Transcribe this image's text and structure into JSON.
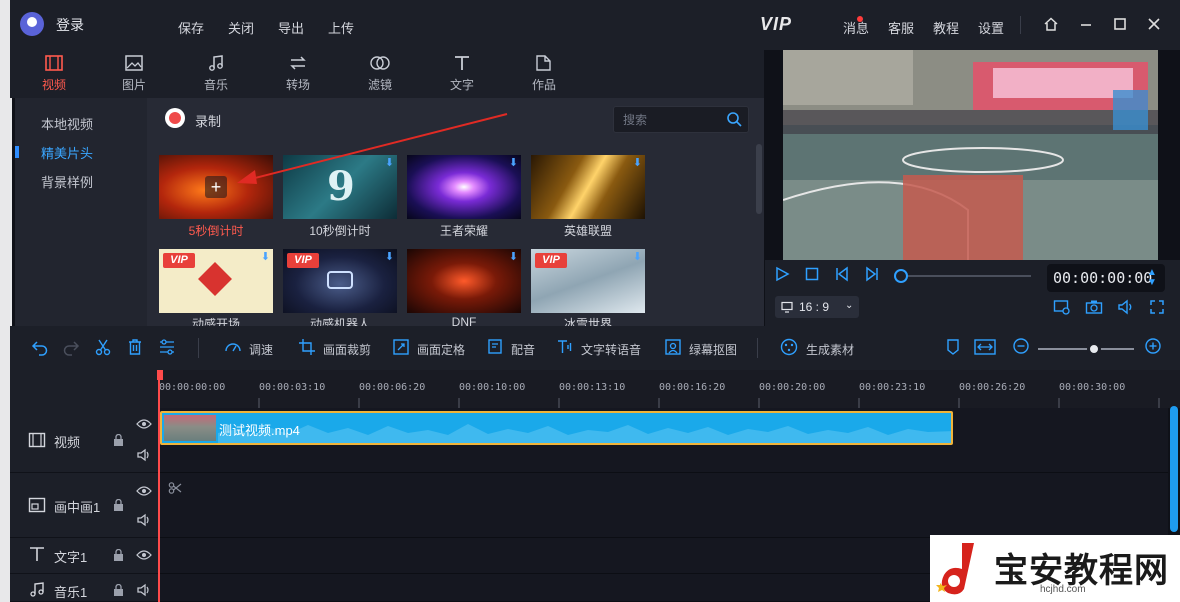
{
  "titlebar": {
    "login": "登录",
    "menu": [
      "保存",
      "关闭",
      "导出",
      "上传"
    ],
    "vip": "VIP",
    "right": [
      "消息",
      "客服",
      "教程",
      "设置"
    ]
  },
  "tools": [
    {
      "label": "视频",
      "icon": "film-icon",
      "active": true
    },
    {
      "label": "图片",
      "icon": "image-icon"
    },
    {
      "label": "音乐",
      "icon": "music-icon"
    },
    {
      "label": "转场",
      "icon": "transition-icon"
    },
    {
      "label": "滤镜",
      "icon": "filter-icon"
    },
    {
      "label": "文字",
      "icon": "text-icon"
    },
    {
      "label": "作品",
      "icon": "folder-icon"
    }
  ],
  "sidenav": [
    "本地视频",
    "精美片头",
    "背景样例"
  ],
  "sidenav_active": 1,
  "record_label": "录制",
  "search": {
    "placeholder": "搜索"
  },
  "templates": [
    {
      "label": "5秒倒计时",
      "vip": false,
      "download": false,
      "active": true
    },
    {
      "label": "10秒倒计时",
      "vip": false,
      "download": true
    },
    {
      "label": "王者荣耀",
      "vip": false,
      "download": true
    },
    {
      "label": "英雄联盟",
      "vip": false,
      "download": true
    },
    {
      "label": "动感开场",
      "vip": true,
      "download": true
    },
    {
      "label": "动感机器人",
      "vip": true,
      "download": true
    },
    {
      "label": "DNF",
      "vip": false,
      "download": true
    },
    {
      "label": "冰雪世界",
      "vip": true,
      "download": true
    }
  ],
  "vip_badge": "VIP",
  "player": {
    "time": "00:00:00:00",
    "ratio": "16 : 9",
    "progress": 0
  },
  "edit_tools": [
    "调速",
    "画面裁剪",
    "画面定格",
    "配音",
    "文字转语音",
    "绿幕抠图",
    "生成素材"
  ],
  "ruler_ticks": [
    "00:00:00:00",
    "00:00:03:10",
    "00:00:06:20",
    "00:00:10:00",
    "00:00:13:10",
    "00:00:16:20",
    "00:00:20:00",
    "00:00:23:10",
    "00:00:26:20",
    "00:00:30:00"
  ],
  "tracks": [
    {
      "name": "视频",
      "icon": "film-icon"
    },
    {
      "name": "画中画1",
      "icon": "pip-icon"
    },
    {
      "name": "文字1",
      "icon": "text-icon"
    },
    {
      "name": "音乐1",
      "icon": "music-icon"
    }
  ],
  "clip": {
    "label": "测试视频.mp4"
  },
  "watermark": {
    "text": "宝安教程网",
    "url": "hcjhd.com"
  },
  "colors": {
    "accent": "#2fa0ff",
    "active_red": "#ff5a4e",
    "clip": "#1aa9ea",
    "playhead": "#ff4b4b"
  }
}
